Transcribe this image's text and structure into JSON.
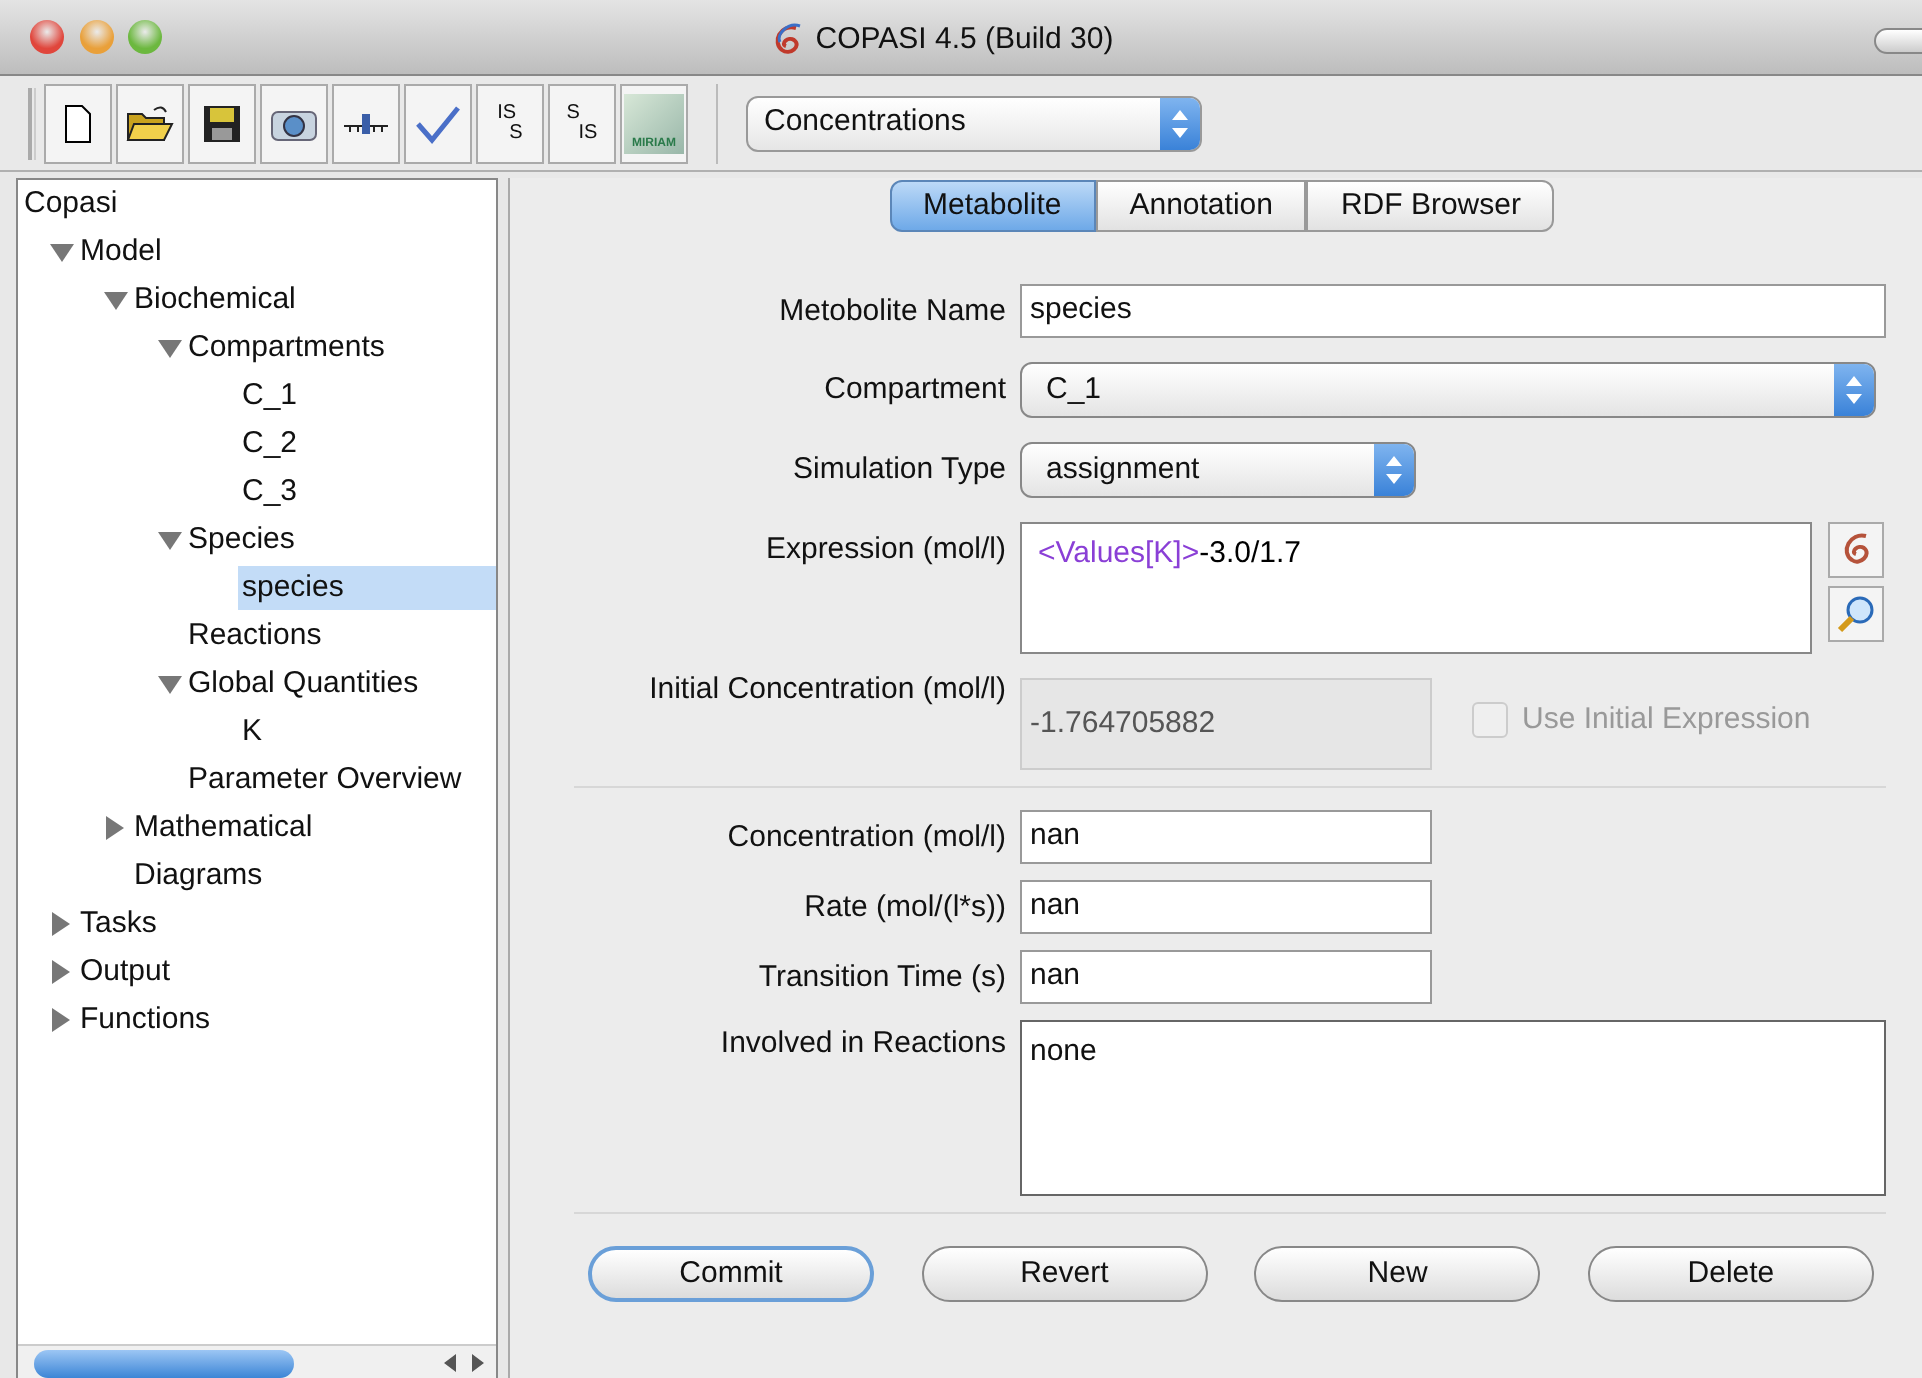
{
  "window": {
    "title": "COPASI 4.5 (Build 30)"
  },
  "toolbar": [
    {
      "kind": "new"
    },
    {
      "kind": "open"
    },
    {
      "kind": "save"
    },
    {
      "kind": "camera"
    },
    {
      "kind": "slider"
    },
    {
      "kind": "check"
    },
    {
      "kind": "convert",
      "top": "IS",
      "bottom": "S"
    },
    {
      "kind": "convert",
      "top": "S",
      "bottom": "IS"
    },
    {
      "kind": "logo",
      "text": "MIRIAM"
    }
  ],
  "unit_selector": {
    "value": "Concentrations"
  },
  "tree": [
    {
      "label": "Copasi",
      "selected": false,
      "children": [
        {
          "label": "Model",
          "selected": false,
          "expanded": true,
          "children": [
            {
              "label": "Biochemical",
              "selected": false,
              "expanded": true,
              "children": [
                {
                  "label": "Compartments",
                  "selected": false,
                  "expanded": true,
                  "children": [
                    {
                      "label": "C_1",
                      "selected": false
                    },
                    {
                      "label": "C_2",
                      "selected": false
                    },
                    {
                      "label": "C_3",
                      "selected": false
                    }
                  ]
                },
                {
                  "label": "Species",
                  "selected": false,
                  "expanded": true,
                  "children": [
                    {
                      "label": "species",
                      "selected": true
                    }
                  ]
                },
                {
                  "label": "Reactions",
                  "selected": false
                },
                {
                  "label": "Global Quantities",
                  "selected": false,
                  "expanded": true,
                  "children": [
                    {
                      "label": "K",
                      "selected": false
                    }
                  ]
                },
                {
                  "label": "Parameter Overview",
                  "selected": false
                }
              ]
            },
            {
              "label": "Mathematical",
              "selected": false,
              "expanded": false
            },
            {
              "label": "Diagrams",
              "selected": false
            }
          ]
        },
        {
          "label": "Tasks",
          "selected": false,
          "expanded": false
        },
        {
          "label": "Output",
          "selected": false,
          "expanded": false
        },
        {
          "label": "Functions",
          "selected": false,
          "expanded": false
        }
      ]
    }
  ],
  "tabs": [
    {
      "label": "Metabolite",
      "selected": true
    },
    {
      "label": "Annotation",
      "selected": false
    },
    {
      "label": "RDF Browser",
      "selected": false
    }
  ],
  "form_top": [
    {
      "kind": "text",
      "label": "Metobolite Name",
      "value": "species"
    },
    {
      "kind": "select",
      "label": "Compartment",
      "value": "C_1"
    },
    {
      "kind": "select",
      "label": "Simulation Type",
      "value": "assignment"
    },
    {
      "kind": "expression",
      "label": "Expression (mol/l)",
      "tokens": [
        {
          "text": "<Values[K]>",
          "color": "#8a3fd6"
        },
        {
          "text": "-3.0/1.7",
          "color": "#000000"
        }
      ]
    },
    {
      "kind": "initial",
      "label": "Initial Concentration (mol/l)",
      "value": "-1.764705882",
      "disabled": true,
      "checkbox": {
        "label": "Use Initial Expression",
        "checked": false,
        "disabled": true
      }
    }
  ],
  "form_bottom": [
    {
      "kind": "text",
      "label": "Concentration (mol/l)",
      "value": "nan"
    },
    {
      "kind": "text",
      "label": "Rate (mol/(l*s))",
      "value": "nan"
    },
    {
      "kind": "text",
      "label": "Transition Time (s)",
      "value": "nan"
    },
    {
      "kind": "area",
      "label": "Involved in Reactions",
      "value": "none"
    }
  ],
  "buttons": [
    {
      "label": "Commit",
      "default": true
    },
    {
      "label": "Revert",
      "default": false
    },
    {
      "label": "New",
      "default": false
    },
    {
      "label": "Delete",
      "default": false
    }
  ]
}
